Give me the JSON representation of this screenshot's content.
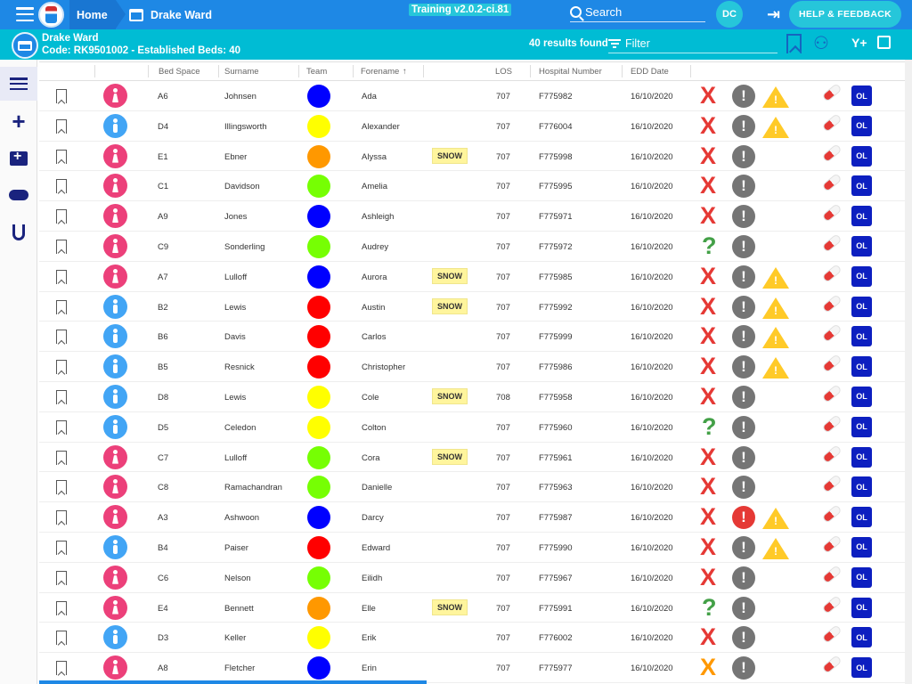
{
  "topbar": {
    "home_label": "Home",
    "ward_crumb": "Drake Ward",
    "version": "Training v2.0.2-ci.81",
    "search_placeholder": "Search",
    "user_initials": "DC",
    "help_label": "HELP & FEEDBACK"
  },
  "wardbar": {
    "ward_name": "Drake Ward",
    "ward_code": "Code: RK9501002 - Established Beds: 40",
    "results": "40 results found",
    "filter_placeholder": "Filter",
    "filter_add_glyph": "Y+"
  },
  "sidebar": {
    "items": [
      {
        "icon": "list-icon"
      },
      {
        "icon": "plus-icon"
      },
      {
        "icon": "medical-kit-icon"
      },
      {
        "icon": "handshake-icon"
      },
      {
        "icon": "stethoscope-icon"
      }
    ]
  },
  "columns": {
    "bed_space": "Bed Space",
    "surname": "Surname",
    "team": "Team",
    "forename": "Forename",
    "sort_arrow": "↑",
    "los": "LOS",
    "hospital_number": "Hospital Number",
    "edd_date": "EDD Date"
  },
  "colors": {
    "blue": "#0000ff",
    "yellow": "#ffff00",
    "orange": "#ff9800",
    "green": "#76ff03",
    "red": "#ff0000"
  },
  "rows": [
    {
      "gender": "F",
      "bed": "A6",
      "surname": "Johnsen",
      "team": "blue",
      "forename": "Ada",
      "snow": "",
      "los": "707",
      "hosp": "F775982",
      "edd": "16/10/2020",
      "status": "x",
      "alert": "grey",
      "warn": true
    },
    {
      "gender": "M",
      "bed": "D4",
      "surname": "Illingsworth",
      "team": "yellow",
      "forename": "Alexander",
      "snow": "",
      "los": "707",
      "hosp": "F776004",
      "edd": "16/10/2020",
      "status": "x",
      "alert": "grey",
      "warn": true
    },
    {
      "gender": "F",
      "bed": "E1",
      "surname": "Ebner",
      "team": "orange",
      "forename": "Alyssa",
      "snow": "SNOW",
      "los": "707",
      "hosp": "F775998",
      "edd": "16/10/2020",
      "status": "x",
      "alert": "grey",
      "warn": false
    },
    {
      "gender": "F",
      "bed": "C1",
      "surname": "Davidson",
      "team": "green",
      "forename": "Amelia",
      "snow": "",
      "los": "707",
      "hosp": "F775995",
      "edd": "16/10/2020",
      "status": "x",
      "alert": "grey",
      "warn": false
    },
    {
      "gender": "F",
      "bed": "A9",
      "surname": "Jones",
      "team": "blue",
      "forename": "Ashleigh",
      "snow": "",
      "los": "707",
      "hosp": "F775971",
      "edd": "16/10/2020",
      "status": "x",
      "alert": "grey",
      "warn": false
    },
    {
      "gender": "F",
      "bed": "C9",
      "surname": "Sonderling",
      "team": "green",
      "forename": "Audrey",
      "snow": "",
      "los": "707",
      "hosp": "F775972",
      "edd": "16/10/2020",
      "status": "q",
      "alert": "grey",
      "warn": false
    },
    {
      "gender": "F",
      "bed": "A7",
      "surname": "Lulloff",
      "team": "blue",
      "forename": "Aurora",
      "snow": "SNOW",
      "los": "707",
      "hosp": "F775985",
      "edd": "16/10/2020",
      "status": "x",
      "alert": "grey",
      "warn": true
    },
    {
      "gender": "M",
      "bed": "B2",
      "surname": "Lewis",
      "team": "red",
      "forename": "Austin",
      "snow": "SNOW",
      "los": "707",
      "hosp": "F775992",
      "edd": "16/10/2020",
      "status": "x",
      "alert": "grey",
      "warn": true
    },
    {
      "gender": "M",
      "bed": "B6",
      "surname": "Davis",
      "team": "red",
      "forename": "Carlos",
      "snow": "",
      "los": "707",
      "hosp": "F775999",
      "edd": "16/10/2020",
      "status": "x",
      "alert": "grey",
      "warn": true
    },
    {
      "gender": "M",
      "bed": "B5",
      "surname": "Resnick",
      "team": "red",
      "forename": "Christopher",
      "snow": "",
      "los": "707",
      "hosp": "F775986",
      "edd": "16/10/2020",
      "status": "x",
      "alert": "grey",
      "warn": true
    },
    {
      "gender": "M",
      "bed": "D8",
      "surname": "Lewis",
      "team": "yellow",
      "forename": "Cole",
      "snow": "SNOW",
      "los": "708",
      "hosp": "F775958",
      "edd": "16/10/2020",
      "status": "x",
      "alert": "grey",
      "warn": false
    },
    {
      "gender": "M",
      "bed": "D5",
      "surname": "Celedon",
      "team": "yellow",
      "forename": "Colton",
      "snow": "",
      "los": "707",
      "hosp": "F775960",
      "edd": "16/10/2020",
      "status": "q",
      "alert": "grey",
      "warn": false
    },
    {
      "gender": "F",
      "bed": "C7",
      "surname": "Lulloff",
      "team": "green",
      "forename": "Cora",
      "snow": "SNOW",
      "los": "707",
      "hosp": "F775961",
      "edd": "16/10/2020",
      "status": "x",
      "alert": "grey",
      "warn": false
    },
    {
      "gender": "F",
      "bed": "C8",
      "surname": "Ramachandran",
      "team": "green",
      "forename": "Danielle",
      "snow": "",
      "los": "707",
      "hosp": "F775963",
      "edd": "16/10/2020",
      "status": "x",
      "alert": "grey",
      "warn": false
    },
    {
      "gender": "F",
      "bed": "A3",
      "surname": "Ashwoon",
      "team": "blue",
      "forename": "Darcy",
      "snow": "",
      "los": "707",
      "hosp": "F775987",
      "edd": "16/10/2020",
      "status": "x",
      "alert": "red",
      "warn": true
    },
    {
      "gender": "M",
      "bed": "B4",
      "surname": "Paiser",
      "team": "red",
      "forename": "Edward",
      "snow": "",
      "los": "707",
      "hosp": "F775990",
      "edd": "16/10/2020",
      "status": "x",
      "alert": "grey",
      "warn": true
    },
    {
      "gender": "F",
      "bed": "C6",
      "surname": "Nelson",
      "team": "green",
      "forename": "Eilidh",
      "snow": "",
      "los": "707",
      "hosp": "F775967",
      "edd": "16/10/2020",
      "status": "x",
      "alert": "grey",
      "warn": false
    },
    {
      "gender": "F",
      "bed": "E4",
      "surname": "Bennett",
      "team": "orange",
      "forename": "Elle",
      "snow": "SNOW",
      "los": "707",
      "hosp": "F775991",
      "edd": "16/10/2020",
      "status": "q",
      "alert": "grey",
      "warn": false
    },
    {
      "gender": "M",
      "bed": "D3",
      "surname": "Keller",
      "team": "yellow",
      "forename": "Erik",
      "snow": "",
      "los": "707",
      "hosp": "F776002",
      "edd": "16/10/2020",
      "status": "x",
      "alert": "grey",
      "warn": false
    },
    {
      "gender": "F",
      "bed": "A8",
      "surname": "Fletcher",
      "team": "blue",
      "forename": "Erin",
      "snow": "",
      "los": "707",
      "hosp": "F775977",
      "edd": "16/10/2020",
      "status": "xo",
      "alert": "grey",
      "warn": false
    }
  ],
  "glyphs": {
    "x": "X",
    "q": "?",
    "exclaim": "!",
    "ol": "OL",
    "plus": "+",
    "logout": "⇥"
  }
}
